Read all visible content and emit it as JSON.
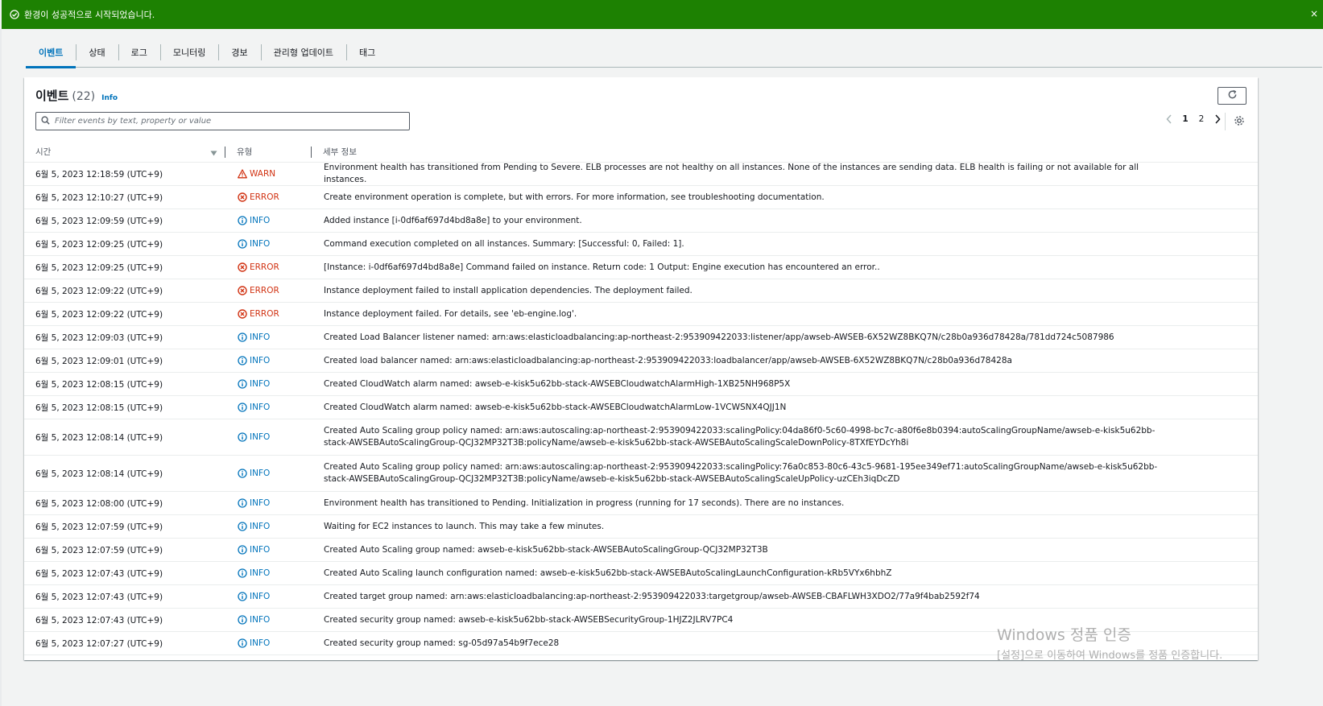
{
  "banner": {
    "message": "환경이 성공적으로 시작되었습니다.",
    "close": "×",
    "color": "#1d8102"
  },
  "tabs": [
    {
      "label": "이벤트",
      "active": true
    },
    {
      "label": "상태"
    },
    {
      "label": "로그"
    },
    {
      "label": "모니터링"
    },
    {
      "label": "경보"
    },
    {
      "label": "관리형 업데이트"
    },
    {
      "label": "태그"
    }
  ],
  "events_panel": {
    "title": "이벤트",
    "count": "(22)",
    "info_link": "Info",
    "filter_placeholder": "Filter events by text, property or value",
    "pagination": {
      "pages": [
        "1",
        "2"
      ],
      "current": "1"
    }
  },
  "table": {
    "columns": {
      "time": "시간",
      "type": "유형",
      "detail": "세부 정보"
    },
    "rows": [
      {
        "time": "6월 5, 2023 12:18:59 (UTC+9)",
        "type": "WARN",
        "detail": "Environment health has transitioned from Pending to Severe. ELB processes are not healthy on all instances. None of the instances are sending data. ELB health is failing or not available for all instances."
      },
      {
        "time": "6월 5, 2023 12:10:27 (UTC+9)",
        "type": "ERROR",
        "detail": "Create environment operation is complete, but with errors. For more information, see troubleshooting documentation."
      },
      {
        "time": "6월 5, 2023 12:09:59 (UTC+9)",
        "type": "INFO",
        "detail": "Added instance [i-0df6af697d4bd8a8e] to your environment."
      },
      {
        "time": "6월 5, 2023 12:09:25 (UTC+9)",
        "type": "INFO",
        "detail": "Command execution completed on all instances. Summary: [Successful: 0, Failed: 1]."
      },
      {
        "time": "6월 5, 2023 12:09:25 (UTC+9)",
        "type": "ERROR",
        "detail": "[Instance: i-0df6af697d4bd8a8e] Command failed on instance. Return code: 1 Output: Engine execution has encountered an error.."
      },
      {
        "time": "6월 5, 2023 12:09:22 (UTC+9)",
        "type": "ERROR",
        "detail": "Instance deployment failed to install application dependencies. The deployment failed."
      },
      {
        "time": "6월 5, 2023 12:09:22 (UTC+9)",
        "type": "ERROR",
        "detail": "Instance deployment failed. For details, see 'eb-engine.log'."
      },
      {
        "time": "6월 5, 2023 12:09:03 (UTC+9)",
        "type": "INFO",
        "detail": "Created Load Balancer listener named: arn:aws:elasticloadbalancing:ap-northeast-2:953909422033:listener/app/awseb-AWSEB-6X52WZ8BKQ7N/c28b0a936d78428a/781dd724c5087986"
      },
      {
        "time": "6월 5, 2023 12:09:01 (UTC+9)",
        "type": "INFO",
        "detail": "Created load balancer named: arn:aws:elasticloadbalancing:ap-northeast-2:953909422033:loadbalancer/app/awseb-AWSEB-6X52WZ8BKQ7N/c28b0a936d78428a"
      },
      {
        "time": "6월 5, 2023 12:08:15 (UTC+9)",
        "type": "INFO",
        "detail": "Created CloudWatch alarm named: awseb-e-kisk5u62bb-stack-AWSEBCloudwatchAlarmHigh-1XB25NH968P5X"
      },
      {
        "time": "6월 5, 2023 12:08:15 (UTC+9)",
        "type": "INFO",
        "detail": "Created CloudWatch alarm named: awseb-e-kisk5u62bb-stack-AWSEBCloudwatchAlarmLow-1VCWSNX4QJJ1N"
      },
      {
        "time": "6월 5, 2023 12:08:14 (UTC+9)",
        "type": "INFO",
        "detail": "Created Auto Scaling group policy named: arn:aws:autoscaling:ap-northeast-2:953909422033:scalingPolicy:04da86f0-5c60-4998-bc7c-a80f6e8b0394:autoScalingGroupName/awseb-e-kisk5u62bb-stack-AWSEBAutoScalingGroup-QCJ32MP32T3B:policyName/awseb-e-kisk5u62bb-stack-AWSEBAutoScalingScaleDownPolicy-8TXfEYDcYh8i"
      },
      {
        "time": "6월 5, 2023 12:08:14 (UTC+9)",
        "type": "INFO",
        "detail": "Created Auto Scaling group policy named: arn:aws:autoscaling:ap-northeast-2:953909422033:scalingPolicy:76a0c853-80c6-43c5-9681-195ee349ef71:autoScalingGroupName/awseb-e-kisk5u62bb-stack-AWSEBAutoScalingGroup-QCJ32MP32T3B:policyName/awseb-e-kisk5u62bb-stack-AWSEBAutoScalingScaleUpPolicy-uzCEh3iqDcZD"
      },
      {
        "time": "6월 5, 2023 12:08:00 (UTC+9)",
        "type": "INFO",
        "detail": "Environment health has transitioned to Pending. Initialization in progress (running for 17 seconds). There are no instances."
      },
      {
        "time": "6월 5, 2023 12:07:59 (UTC+9)",
        "type": "INFO",
        "detail": "Waiting for EC2 instances to launch. This may take a few minutes."
      },
      {
        "time": "6월 5, 2023 12:07:59 (UTC+9)",
        "type": "INFO",
        "detail": "Created Auto Scaling group named: awseb-e-kisk5u62bb-stack-AWSEBAutoScalingGroup-QCJ32MP32T3B"
      },
      {
        "time": "6월 5, 2023 12:07:43 (UTC+9)",
        "type": "INFO",
        "detail": "Created Auto Scaling launch configuration named: awseb-e-kisk5u62bb-stack-AWSEBAutoScalingLaunchConfiguration-kRb5VYx6hbhZ"
      },
      {
        "time": "6월 5, 2023 12:07:43 (UTC+9)",
        "type": "INFO",
        "detail": "Created target group named: arn:aws:elasticloadbalancing:ap-northeast-2:953909422033:targetgroup/awseb-AWSEB-CBAFLWH3XDO2/77a9f4bab2592f74"
      },
      {
        "time": "6월 5, 2023 12:07:43 (UTC+9)",
        "type": "INFO",
        "detail": "Created security group named: awseb-e-kisk5u62bb-stack-AWSEBSecurityGroup-1HJZ2JLRV7PC4"
      },
      {
        "time": "6월 5, 2023 12:07:27 (UTC+9)",
        "type": "INFO",
        "detail": "Created security group named: sg-05d97a54b9f7ece28"
      }
    ]
  },
  "watermark": {
    "line1": "Windows 정품 인증",
    "line2": "[설정]으로 이동하여 Windows를 정품 인증합니다."
  },
  "colors": {
    "accent": "#0073bb",
    "error": "#d13212",
    "warn": "#d13212",
    "success": "#1d8102"
  }
}
